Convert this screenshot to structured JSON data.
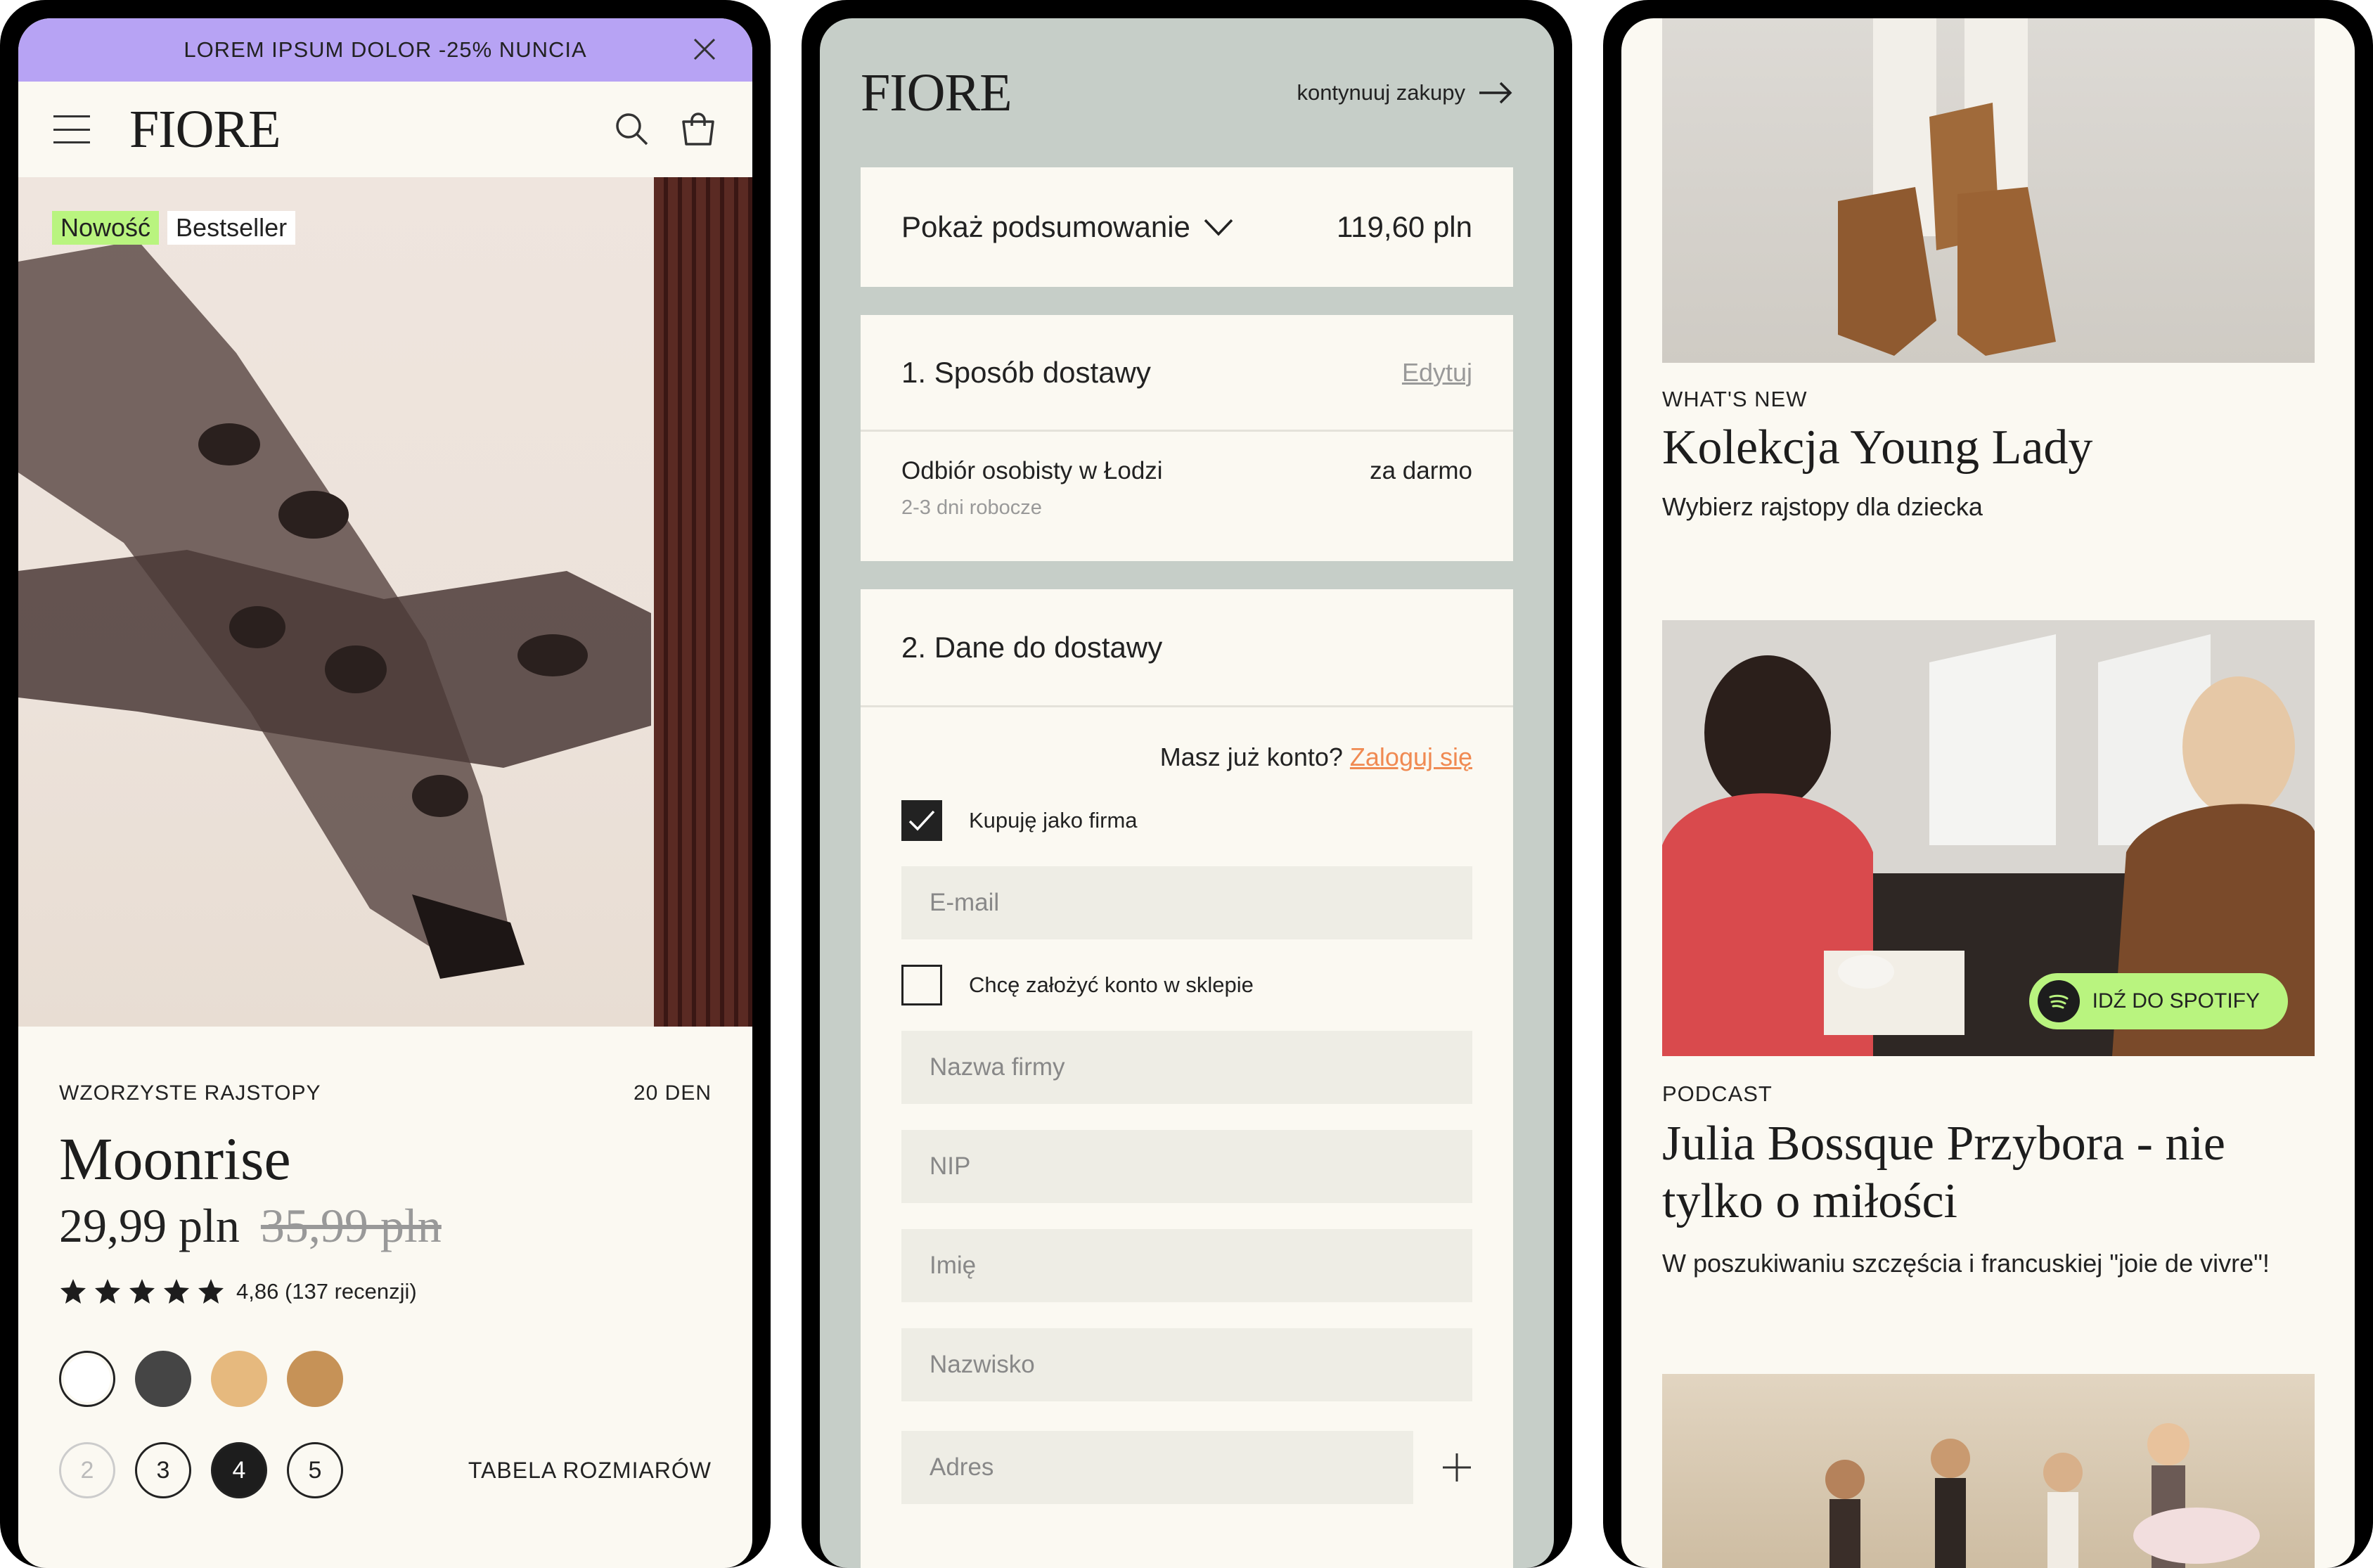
{
  "product_page": {
    "promo_text": "LOREM IPSUM DOLOR -25% NUNCIA",
    "logo": "FIORE",
    "badge_new": "Nowość",
    "badge_best": "Bestseller",
    "category": "WZORZYSTE RAJSTOPY",
    "den": "20 DEN",
    "name": "Moonrise",
    "price": "29,99 pln",
    "old_price": "35,99 pln",
    "rating_text": "4,86 (137 recenzji)",
    "rating_stars": 5,
    "swatch_colors": [
      "#ffffff",
      "#454545",
      "#e6b97e",
      "#c69257"
    ],
    "sizes": [
      "2",
      "3",
      "4",
      "5"
    ],
    "selected_size": "4",
    "disabled_size": "2",
    "size_table": "TABELA ROZMIARÓW"
  },
  "checkout_page": {
    "logo": "FIORE",
    "continue": "kontynuuj zakupy",
    "summary_label": "Pokaż podsumowanie",
    "summary_total": "119,60 pln",
    "step1": {
      "title": "1. Sposób dostawy",
      "edit": "Edytuj",
      "method": "Odbiór osobisty w Łodzi",
      "method_price": "za darmo",
      "method_time": "2-3 dni robocze"
    },
    "step2": {
      "title": "2. Dane do dostawy",
      "account_question": "Masz już konto?",
      "login_link": "Zaloguj się",
      "company_checkbox": "Kupuję jako firma",
      "company_checked": true,
      "email_placeholder": "E-mail",
      "create_account": "Chcę założyć konto w sklepie",
      "company_placeholder": "Nazwa firmy",
      "nip_placeholder": "NIP",
      "first_name_placeholder": "Imię",
      "last_name_placeholder": "Nazwisko",
      "address_placeholder": "Adres"
    }
  },
  "blog_page": {
    "article1": {
      "kicker": "WHAT'S NEW",
      "title": "Kolekcja Young Lady",
      "desc": "Wybierz rajstopy dla dziecka"
    },
    "spotify_button": "IDŹ DO SPOTIFY",
    "article2": {
      "kicker": "PODCAST",
      "title": "Julia Bossque Przybora - nie tylko o miłości",
      "desc": "W poszukiwaniu szczęścia i francuskiej \"joie de vivre\"!"
    }
  }
}
